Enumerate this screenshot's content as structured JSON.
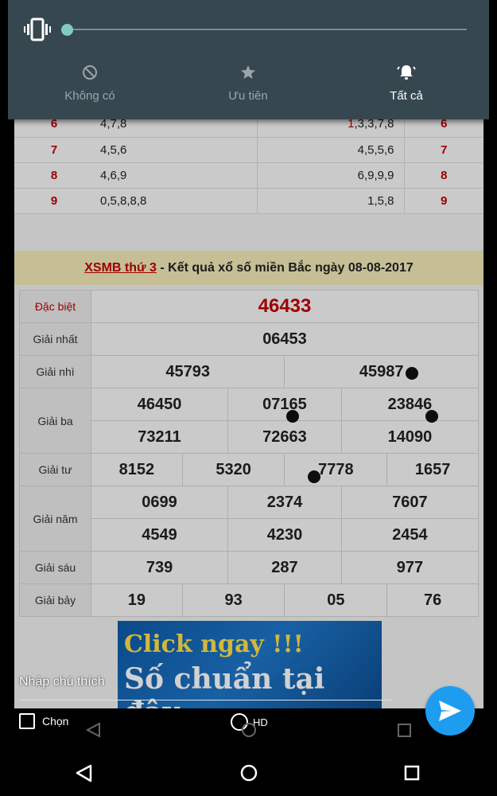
{
  "shade": {
    "modes": [
      {
        "label": "Không có",
        "icon": "block-icon"
      },
      {
        "label": "Ưu tiên",
        "icon": "star-icon"
      },
      {
        "label": "Tất cả",
        "icon": "bell-icon"
      }
    ],
    "active_mode": "Tất cả",
    "volume_level": 0
  },
  "top_table": {
    "rows": [
      {
        "left_num": "6",
        "left_vals": "4,7,8",
        "right_vals_first": "1",
        "right_vals_rest": ",3,3,7,8",
        "right_num": "6"
      },
      {
        "left_num": "7",
        "left_vals": "4,5,6",
        "right_vals_first": "",
        "right_vals_rest": "4,5,5,6",
        "right_num": "7"
      },
      {
        "left_num": "8",
        "left_vals": "4,6,9",
        "right_vals_first": "",
        "right_vals_rest": "6,9,9,9",
        "right_num": "8"
      },
      {
        "left_num": "9",
        "left_vals": "0,5,8,8,8",
        "right_vals_first": "",
        "right_vals_rest": "1,5,8",
        "right_num": "9"
      }
    ]
  },
  "banner": {
    "link": "XSMB thứ 3",
    "text": " - Kết quả xổ số miền Bắc ngày 08-08-2017"
  },
  "results": {
    "dac_biet": {
      "label": "Đặc biệt",
      "value": "46433"
    },
    "giai_nhat": {
      "label": "Giải nhất",
      "value": "06453"
    },
    "giai_nhi": {
      "label": "Giải nhì",
      "values": [
        "45793",
        "45987"
      ]
    },
    "giai_ba": {
      "label": "Giải ba",
      "values": [
        "46450",
        "07165",
        "23846",
        "73211",
        "72663",
        "14090"
      ]
    },
    "giai_tu": {
      "label": "Giải tư",
      "values": [
        "8152",
        "5320",
        "7778",
        "1657"
      ]
    },
    "giai_nam": {
      "label": "Giải năm",
      "values": [
        "0699",
        "2374",
        "7607",
        "4549",
        "4230",
        "2454"
      ]
    },
    "giai_sau": {
      "label": "Giải sáu",
      "values": [
        "739",
        "287",
        "977"
      ]
    },
    "giai_bay": {
      "label": "Giải bảy",
      "values": [
        "19",
        "93",
        "05",
        "76"
      ]
    }
  },
  "ad": {
    "line1": "Click ngay !!!",
    "line2": "Số chuẩn tại đây"
  },
  "caption": {
    "placeholder": "Nhập chú thích"
  },
  "controls": {
    "select_label": "Chọn",
    "hd_label": "HD"
  },
  "colors": {
    "accent": "#1e9df0",
    "shade_bg": "#37474f",
    "thumb": "#80cbc4",
    "prize_red": "#c00000"
  }
}
